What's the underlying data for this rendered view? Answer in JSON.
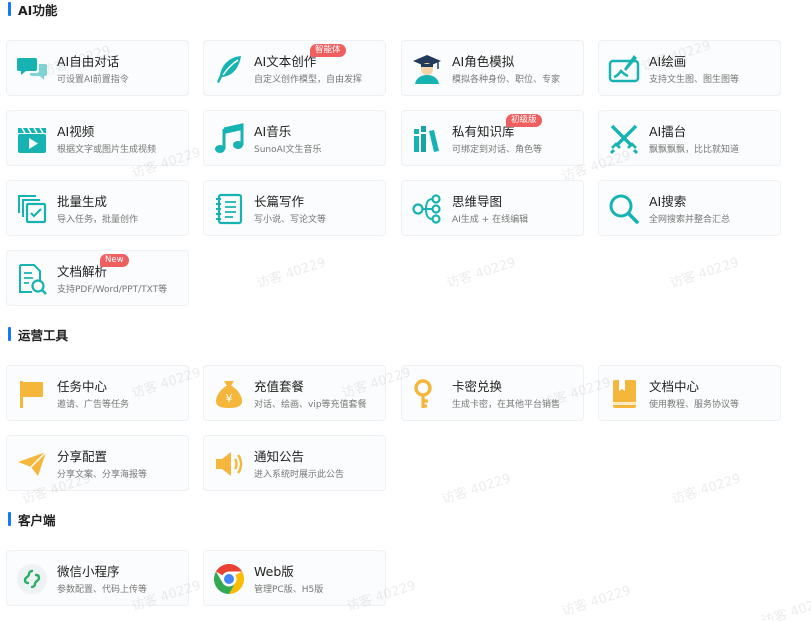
{
  "sections": {
    "ai": {
      "title": "AI功能"
    },
    "ops": {
      "title": "运营工具"
    },
    "client": {
      "title": "客户端"
    }
  },
  "cards": {
    "ai_chat": {
      "name": "AI自由对话",
      "desc": "可设置AI前置指令",
      "icon": "chat-bubbles-icon"
    },
    "ai_writing": {
      "name": "AI文本创作",
      "desc": "自定义创作模型，自由发挥",
      "badge": "智能体",
      "icon": "feather-pen-icon"
    },
    "ai_roleplay": {
      "name": "AI角色模拟",
      "desc": "模拟各种身份、职位、专家",
      "icon": "graduate-icon"
    },
    "ai_painting": {
      "name": "AI绘画",
      "desc": "支持文生图、图生图等",
      "icon": "paint-brush-icon"
    },
    "ai_video": {
      "name": "AI视频",
      "desc": "根据文字或图片生成视频",
      "icon": "video-clapper-icon"
    },
    "ai_music": {
      "name": "AI音乐",
      "desc": "SunoAI文生音乐",
      "icon": "music-note-icon"
    },
    "knowledge": {
      "name": "私有知识库",
      "desc": "可绑定到对话、角色等",
      "badge": "初级版",
      "icon": "books-icon"
    },
    "ai_arena": {
      "name": "AI擂台",
      "desc": "飘飘飘飘，比比就知道",
      "icon": "crossed-swords-icon"
    },
    "batch": {
      "name": "批量生成",
      "desc": "导入任务，批量创作",
      "icon": "stacked-checklist-icon"
    },
    "long_writing": {
      "name": "长篇写作",
      "desc": "写小说、写论文等",
      "icon": "notebook-icon"
    },
    "mindmap": {
      "name": "思维导图",
      "desc": "AI生成 + 在线编辑",
      "icon": "mindmap-icon"
    },
    "ai_search": {
      "name": "AI搜索",
      "desc": "全网搜索并整合汇总",
      "icon": "magnifier-icon"
    },
    "doc_parse": {
      "name": "文档解析",
      "desc": "支持PDF/Word/PPT/TXT等",
      "badge": "New",
      "icon": "document-search-icon"
    },
    "task_center": {
      "name": "任务中心",
      "desc": "邀请、广告等任务",
      "icon": "flag-icon"
    },
    "recharge": {
      "name": "充值套餐",
      "desc": "对话、绘画、vip等充值套餐",
      "icon": "money-bag-icon"
    },
    "card_code": {
      "name": "卡密兑换",
      "desc": "生成卡密，在其他平台销售",
      "icon": "key-icon"
    },
    "doc_center": {
      "name": "文档中心",
      "desc": "使用教程、服务协议等",
      "icon": "book-icon"
    },
    "share": {
      "name": "分享配置",
      "desc": "分享文案、分享海报等",
      "icon": "paper-plane-icon"
    },
    "notice": {
      "name": "通知公告",
      "desc": "进入系统时展示此公告",
      "icon": "speaker-icon"
    },
    "miniprogram": {
      "name": "微信小程序",
      "desc": "参数配置、代码上传等",
      "icon": "wechat-miniprogram-icon"
    },
    "web": {
      "name": "Web版",
      "desc": "管理PC版、H5版",
      "icon": "chrome-icon"
    }
  },
  "watermark": "访客 40229",
  "colors": {
    "accent": "#1677ff",
    "teal": "#17b3b3",
    "amber": "#f4b73c",
    "badge": "#ef5f5f"
  }
}
